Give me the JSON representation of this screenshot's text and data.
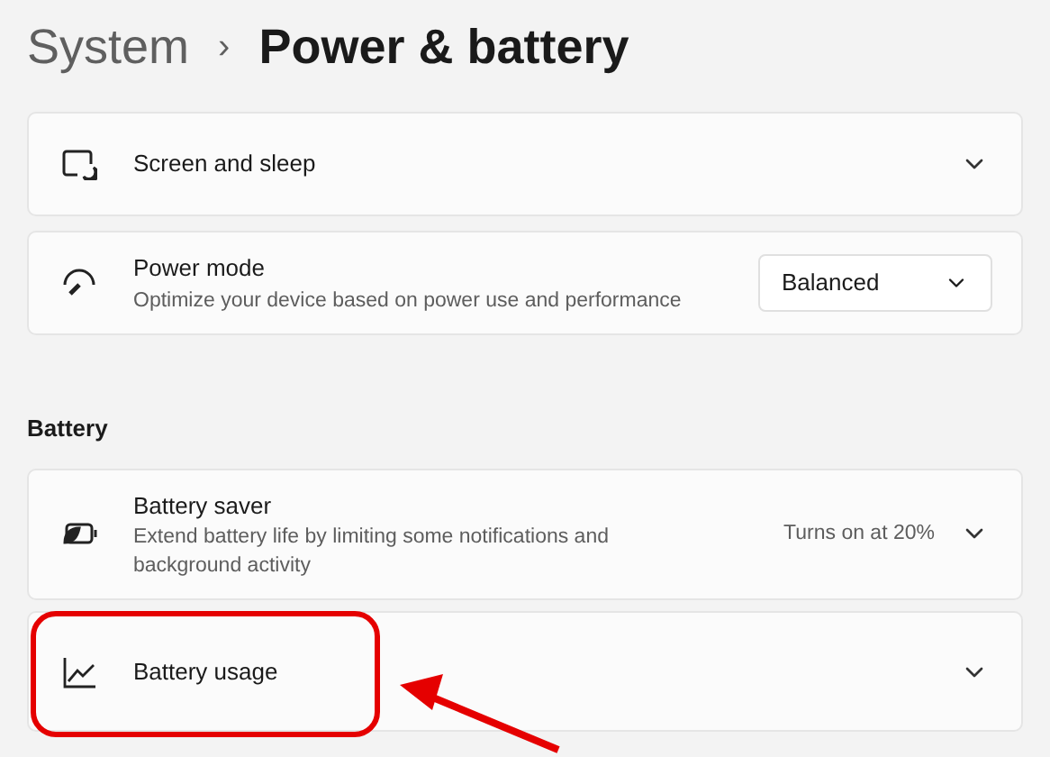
{
  "breadcrumb": {
    "parent": "System",
    "separator": "›",
    "current": "Power & battery"
  },
  "groups": [
    {
      "cards": [
        {
          "kind": "expander",
          "title": "Screen and sleep"
        },
        {
          "kind": "dropdown",
          "title": "Power mode",
          "description": "Optimize your device based on power use and performance",
          "value": "Balanced"
        }
      ]
    },
    {
      "heading": "Battery",
      "cards": [
        {
          "kind": "expander",
          "title": "Battery saver",
          "description": "Extend battery life by limiting some notifications and background activity",
          "status": "Turns on at 20%"
        },
        {
          "kind": "expander",
          "title": "Battery usage",
          "highlighted": true
        }
      ]
    }
  ]
}
